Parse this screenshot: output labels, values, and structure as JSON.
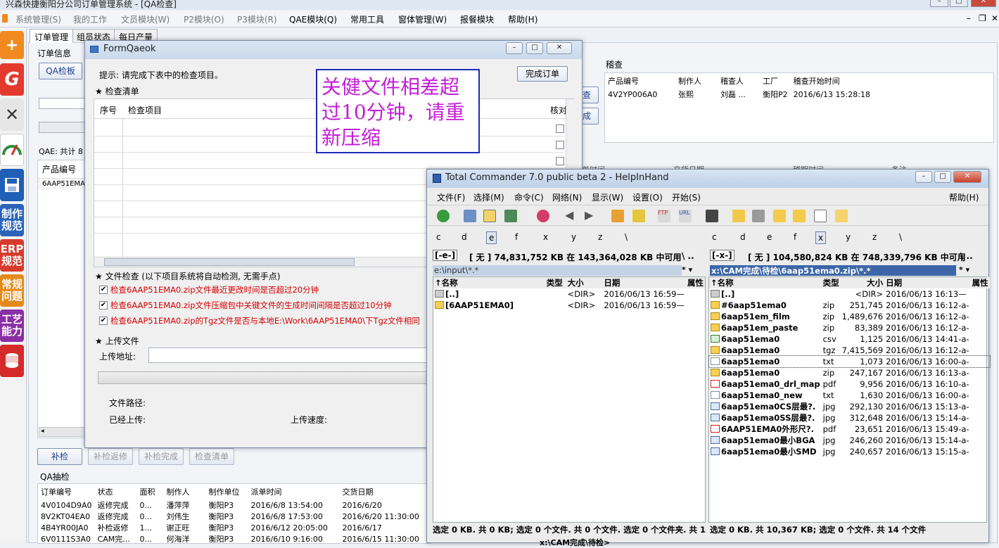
{
  "app": {
    "title": "兴森快捷衡阳分公司订单管理系统 - [QA检查]",
    "menu": [
      "系统管理(S)",
      "我的工作",
      "文员模块(W)",
      "P2模块(O)",
      "P3模块(R)",
      "QAE模块(Q)",
      "常用工具",
      "窗体管理(W)",
      "报餐模块",
      "帮助(H)"
    ]
  },
  "sidebar": {
    "items": [
      {
        "label": "",
        "icon": "add-icon",
        "color": "#f08a1e"
      },
      {
        "label": "",
        "icon": "g-logo-icon",
        "color": "#e23a2d"
      },
      {
        "label": "",
        "icon": "tools-icon",
        "color": "#555555"
      },
      {
        "label": "",
        "icon": "gauge-icon",
        "color": "#2f8d3e"
      },
      {
        "label": "",
        "icon": "floppy-icon",
        "color": "#1f5fb8"
      },
      {
        "label": "制作\n规范",
        "icon": "",
        "color": "#2a63b9"
      },
      {
        "label": "ERP\n规范",
        "icon": "",
        "color": "#d63b2c"
      },
      {
        "label": "常规\n问题",
        "icon": "",
        "color": "#e58a1a"
      },
      {
        "label": "工艺\n能力",
        "icon": "",
        "color": "#8a2fa5"
      },
      {
        "label": "",
        "icon": "database-icon",
        "color": "#d42a2a"
      }
    ]
  },
  "tabs": [
    "订单管理",
    "组员状态",
    "每日产量"
  ],
  "bg": {
    "order_info": "订单信息",
    "qa_board_btn": "QA检板",
    "qae_total": "QAE: 共计 8",
    "left_col_header": "产品编号",
    "left_row": "6AAP51EMA0",
    "audit_title": "稽查",
    "audit_headers": [
      "产品编号",
      "制作人",
      "稽查人",
      "工厂",
      "稽查开始时间"
    ],
    "audit_row": [
      "4V2YP006A0",
      "张熙",
      "刘磊 ...",
      "衡阳P2",
      "2016/6/13 15:28:18"
    ],
    "side_btn1": "查",
    "side_btn2": "成",
    "mid_headers": [
      "单时间",
      "交货日期",
      "稽期时间",
      "备注"
    ],
    "bottom_buttons": [
      "补检",
      "补检返修",
      "补检完成",
      "检查清单"
    ],
    "qa_sample_title": "QA抽检",
    "sample_headers": [
      "订单编号",
      "状态",
      "面积",
      "制作人",
      "制作单位",
      "派单时间",
      "交货日期"
    ],
    "sample_rows": [
      [
        "4V0104D9A0",
        "返修完成",
        "0...",
        "潘萍萍",
        "衡阳P3",
        "2016/6/8 13:54:00",
        "2016/6/20"
      ],
      [
        "8V2KT04EA0",
        "返修完成",
        "0...",
        "刘伟生",
        "衡阳P3",
        "2016/6/8 17:53:00",
        "2016/6/20 11:30:00"
      ],
      [
        "4B4YR00JA0",
        "补检返修",
        "1...",
        "谢正旺",
        "衡阳P3",
        "2016/6/12 20:05:00",
        "2016/6/17"
      ],
      [
        "6V0111S3A0",
        "CAM完...",
        "0...",
        "何海洋",
        "衡阳P3",
        "2016/6/10 9:16:00",
        "2016/6/15 11:30:00"
      ]
    ]
  },
  "formqaeok": {
    "title": "FormQaeok",
    "hint": "提示: 请完成下表中的检查项目。",
    "complete_btn": "完成订单",
    "checklist_title": "★ 检查清单",
    "col_seq": "序号",
    "col_item": "检查项目",
    "col_check": "核对",
    "file_check_title": "★ 文件检查 (以下项目系统将自动检测, 无需手点)",
    "checks": [
      "检查6AAP51EMA0.zip文件最近更改时间是否超过20分钟",
      "检查6AAP51EMA0.zip文件压缩包中关键文件的生成时间间隔是否超过10分钟",
      "检查6AAP51EMA0.zip的Tgz文件是否与本地E:\\Work\\6AAP51EMA0\\下Tgz文件相同"
    ],
    "upload_title": "★ 上传文件",
    "upload_addr_label": "上传地址:",
    "upload_addr_value": "",
    "file_path_label": "文件路径:",
    "uploaded_label": "已经上传:",
    "speed_label": "上传速度:"
  },
  "annotation": {
    "text": "关健文件相差超过10分钟，请重新压缩",
    "color": "#c21fd6",
    "border": "#1d2ab8"
  },
  "tc": {
    "title": "Total Commander 7.0 public beta 2 - HelpInHand",
    "menu": [
      "文件(F)",
      "选择(M)",
      "命令(C)",
      "网络(N)",
      "显示(W)",
      "设置(O)",
      "开始(S)"
    ],
    "help": "帮助(H)",
    "drives": [
      "c",
      "d",
      "e",
      "f",
      "x",
      "y",
      "z",
      "\\"
    ],
    "left": {
      "drive": "[-e-]",
      "free": "[ 无 ]  74,831,752 KB 在 143,364,028 KB 中可用",
      "path": "e:\\input\\*.*",
      "headers": [
        "↑名称",
        "类型",
        "大小",
        "日期",
        "属性"
      ],
      "rows": [
        {
          "icon": "up",
          "name": "[..]",
          "type": "",
          "size": "<DIR>",
          "date": "2016/06/13 16:59—"
        },
        {
          "icon": "folder",
          "name": "[6AAP51EMA0]",
          "type": "",
          "size": "<DIR>",
          "date": "2016/06/13 16:59—"
        }
      ],
      "status": "选定 0 KB. 共 0 KB; 选定 0 个文件. 共 0 个文件. 选定 0 个文件夹. 共 1 个文件夹"
    },
    "right": {
      "drive": "[-x-]",
      "free": "[ 无 ]  104,580,824 KB 在 748,339,796 KB 中可用",
      "path": "x:\\CAM完成\\待检\\6aap51ema0.zip\\*.*",
      "headers": [
        "↑名称",
        "类型",
        "大小",
        "日期",
        "属性"
      ],
      "rows": [
        {
          "icon": "up",
          "name": "[..]",
          "type": "",
          "size": "<DIR>",
          "date": "2016/06/13 16:13—"
        },
        {
          "icon": "zip",
          "name": "#6aap51ema0",
          "type": "zip",
          "size": "251,745",
          "date": "2016/06/13 16:12-a-"
        },
        {
          "icon": "zip",
          "name": "6aap51em_film",
          "type": "zip",
          "size": "1,489,676",
          "date": "2016/06/13 16:12-a-"
        },
        {
          "icon": "zip",
          "name": "6aap51em_paste",
          "type": "zip",
          "size": "83,389",
          "date": "2016/06/13 16:12-a-"
        },
        {
          "icon": "xls",
          "name": "6aap51ema0",
          "type": "csv",
          "size": "1,125",
          "date": "2016/06/13 14:41-a-"
        },
        {
          "icon": "zip",
          "name": "6aap51ema0",
          "type": "tgz",
          "size": "7,415,569",
          "date": "2016/06/13 16:12-a-"
        },
        {
          "icon": "doc",
          "name": "6aap51ema0",
          "type": "txt",
          "size": "1,073",
          "date": "2016/06/13 16:00-a-"
        },
        {
          "icon": "zip",
          "name": "6aap51ema0",
          "type": "zip",
          "size": "247,167",
          "date": "2016/06/13 16:13-a-"
        },
        {
          "icon": "pdf",
          "name": "6aap51ema0_drl_map",
          "type": "pdf",
          "size": "9,956",
          "date": "2016/06/13 16:10-a-"
        },
        {
          "icon": "doc",
          "name": "6aap51ema0_new",
          "type": "txt",
          "size": "1,630",
          "date": "2016/06/13 16:00-a-"
        },
        {
          "icon": "img",
          "name": "6aap51ema0CS层最?.",
          "type": "jpg",
          "size": "292,130",
          "date": "2016/06/13 15:13-a-"
        },
        {
          "icon": "img",
          "name": "6aap51ema0SS层最?.",
          "type": "jpg",
          "size": "312,648",
          "date": "2016/06/13 15:14-a-"
        },
        {
          "icon": "pdf",
          "name": "6AAP51EMA0外形尺?.",
          "type": "pdf",
          "size": "23,651",
          "date": "2016/06/13 15:49-a-"
        },
        {
          "icon": "img",
          "name": "6aap51ema0最小BGA",
          "type": "jpg",
          "size": "246,260",
          "date": "2016/06/13 15:14-a-"
        },
        {
          "icon": "img",
          "name": "6aap51ema0最小SMD",
          "type": "jpg",
          "size": "240,657",
          "date": "2016/06/13 15:15-a-"
        }
      ],
      "status": "选定 0 KB. 共 10,367 KB; 选定 0 个文件. 共 14 个文件"
    },
    "cmdline": "x:\\CAM完成\\待检>"
  }
}
